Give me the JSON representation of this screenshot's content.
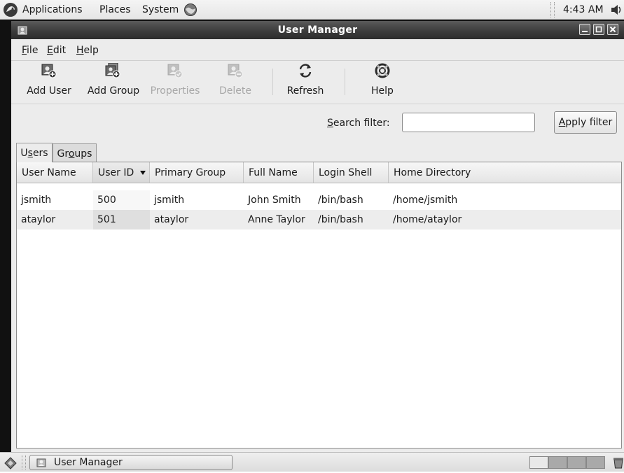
{
  "top_panel": {
    "menus": [
      "Applications",
      "Places",
      "System"
    ],
    "clock": "4:43 AM"
  },
  "window": {
    "title": "User Manager",
    "menubar": [
      {
        "label": "File"
      },
      {
        "label": "Edit"
      },
      {
        "label": "Help"
      }
    ],
    "toolbar": [
      {
        "label": "Add User",
        "icon": "add-user-icon",
        "enabled": true
      },
      {
        "label": "Add Group",
        "icon": "add-group-icon",
        "enabled": true
      },
      {
        "label": "Properties",
        "icon": "properties-icon",
        "enabled": false
      },
      {
        "label": "Delete",
        "icon": "delete-user-icon",
        "enabled": false
      },
      {
        "label": "Refresh",
        "icon": "refresh-icon",
        "enabled": true
      },
      {
        "label": "Help",
        "icon": "help-lifebuoy-icon",
        "enabled": true
      }
    ],
    "search": {
      "label": "Search filter:",
      "value": "",
      "apply_label": "Apply filter"
    },
    "tabs": [
      {
        "label": "Users",
        "active": true
      },
      {
        "label": "Groups",
        "active": false
      }
    ],
    "table": {
      "columns": [
        "User Name",
        "User ID",
        "Primary Group",
        "Full Name",
        "Login Shell",
        "Home Directory"
      ],
      "sorted_column": "User ID",
      "rows": [
        [
          "jsmith",
          "500",
          "jsmith",
          "John Smith",
          "/bin/bash",
          "/home/jsmith"
        ],
        [
          "ataylor",
          "501",
          "ataylor",
          "Anne Taylor",
          "/bin/bash",
          "/home/ataylor"
        ]
      ]
    }
  },
  "bottom_panel": {
    "tasks": [
      {
        "label": "User Manager"
      }
    ],
    "workspaces": 4,
    "active_workspace": 1
  }
}
